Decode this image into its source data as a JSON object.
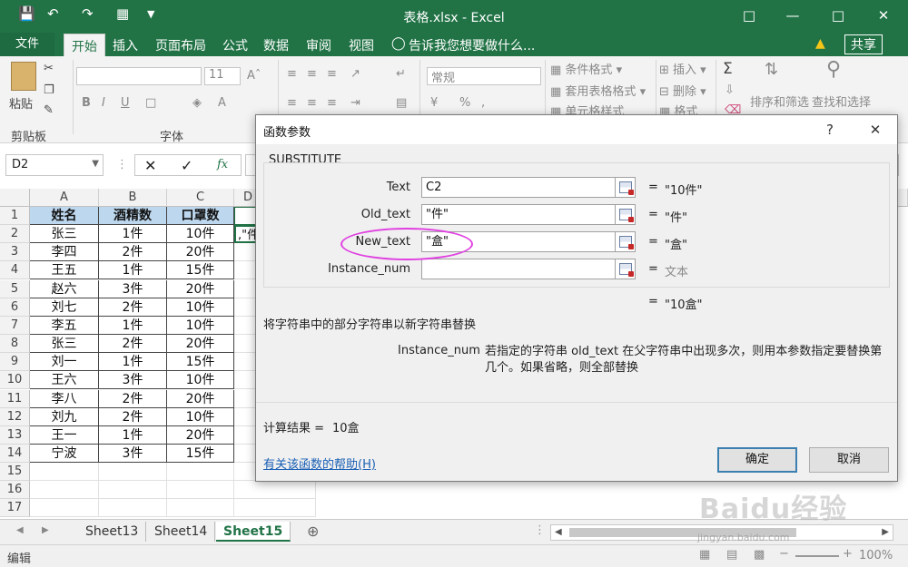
{
  "app": {
    "title": "表格.xlsx - Excel"
  },
  "ribbon_tabs": [
    "文件",
    "开始",
    "插入",
    "页面布局",
    "公式",
    "数据",
    "审阅",
    "视图"
  ],
  "tell_me": "告诉我您想要做什么...",
  "share": "共享",
  "ribbon": {
    "paste": "粘贴",
    "clipboard": "剪贴板",
    "font_group": "字体",
    "font_size": "11",
    "number_format": "常规",
    "cond_format": "条件格式",
    "table_format": "套用表格格式",
    "cell_style": "单元格样式",
    "insert": "插入",
    "delete": "删除",
    "format": "格式",
    "sort_filter": "排序和筛选",
    "find_select": "查找和选择"
  },
  "formula_bar": {
    "name_box": "D2",
    "fx": "fx"
  },
  "grid": {
    "columns": [
      "A",
      "B",
      "C",
      "D"
    ],
    "rows": [
      "1",
      "2",
      "3",
      "4",
      "5",
      "6",
      "7",
      "8",
      "9",
      "10",
      "11",
      "12",
      "13",
      "14",
      "15",
      "16",
      "17"
    ],
    "headers": [
      "姓名",
      "酒精数",
      "口罩数"
    ],
    "data": [
      [
        "张三",
        "1件",
        "10件"
      ],
      [
        "李四",
        "2件",
        "20件"
      ],
      [
        "王五",
        "1件",
        "15件"
      ],
      [
        "赵六",
        "3件",
        "20件"
      ],
      [
        "刘七",
        "2件",
        "10件"
      ],
      [
        "李五",
        "1件",
        "10件"
      ],
      [
        "张三",
        "2件",
        "20件"
      ],
      [
        "刘一",
        "1件",
        "15件"
      ],
      [
        "王六",
        "3件",
        "10件"
      ],
      [
        "李八",
        "2件",
        "20件"
      ],
      [
        "刘九",
        "2件",
        "10件"
      ],
      [
        "王一",
        "1件",
        "20件"
      ],
      [
        "宁波",
        "3件",
        "15件"
      ]
    ],
    "d2_partial": ",\"件"
  },
  "sheets": [
    "Sheet13",
    "Sheet14",
    "Sheet15"
  ],
  "status": {
    "mode": "编辑",
    "zoom": "100%"
  },
  "dialog": {
    "title": "函数参数",
    "help_q": "?",
    "function": "SUBSTITUTE",
    "args": [
      {
        "name": "Text",
        "value": "C2",
        "result": "\"10件\""
      },
      {
        "name": "Old_text",
        "value": "\"件\"",
        "result": "\"件\""
      },
      {
        "name": "New_text",
        "value": "\"盒\"",
        "result": "\"盒\""
      },
      {
        "name": "Instance_num",
        "value": "",
        "result": "文本"
      }
    ],
    "eq": "=",
    "overall_result": "\"10盒\"",
    "description": "将字符串中的部分字符串以新字符串替换",
    "param_name": "Instance_num",
    "param_desc": "若指定的字符串 old_text 在父字符串中出现多次，则用本参数指定要替换第几个。如果省略，则全部替换",
    "calc_label": "计算结果 =",
    "calc_value": "10盒",
    "help_link": "有关该函数的帮助(H)",
    "ok": "确定",
    "cancel": "取消"
  },
  "watermark": "Baidu经验",
  "watermark_url": "jingyan.baidu.com",
  "colors": {
    "excel_green": "#217346",
    "header_fill": "#bdd7ee",
    "highlight_circle": "#e040e0"
  }
}
